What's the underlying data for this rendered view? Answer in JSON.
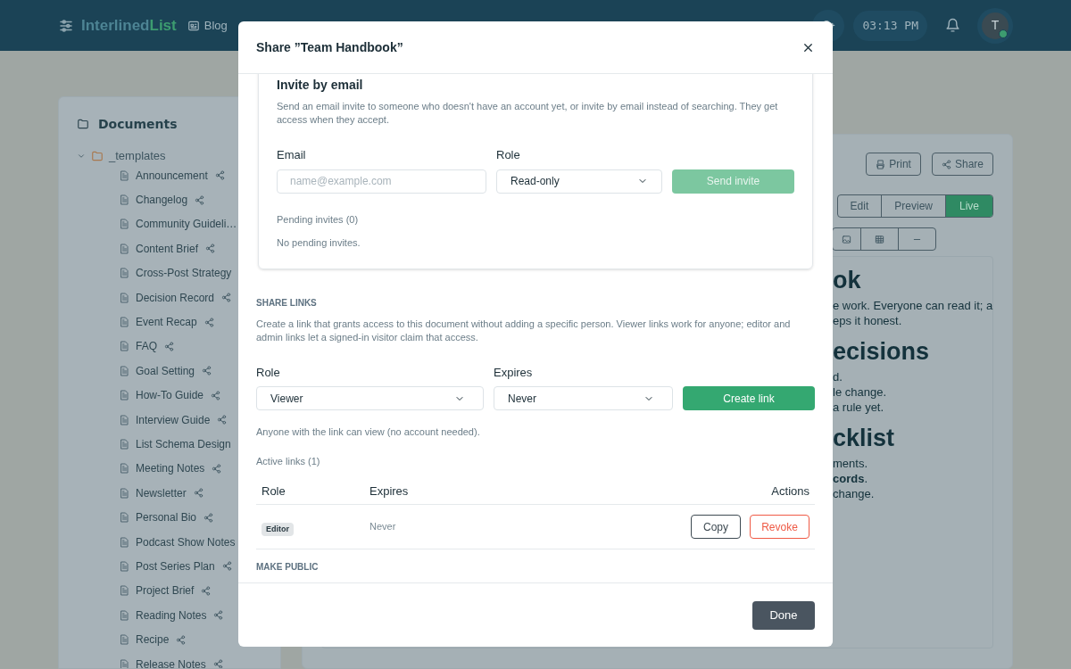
{
  "header": {
    "logo_parts": [
      "Interlined",
      "List"
    ],
    "nav": [
      {
        "label": "Blog"
      }
    ],
    "time": "03:13 PM",
    "avatar": "T"
  },
  "sidebar": {
    "title": "Documents",
    "tree": [
      {
        "label": "_templates",
        "expanded": true,
        "children": [
          {
            "label": "Announcement",
            "shared": true
          },
          {
            "label": "Changelog",
            "shared": true
          },
          {
            "label": "Community Guideli…",
            "shared": false
          },
          {
            "label": "Content Brief",
            "shared": true
          },
          {
            "label": "Cross-Post Strategy",
            "shared": false
          },
          {
            "label": "Decision Record",
            "shared": true
          },
          {
            "label": "Event Recap",
            "shared": true
          },
          {
            "label": "FAQ",
            "shared": true
          },
          {
            "label": "Goal Setting",
            "shared": true
          },
          {
            "label": "How-To Guide",
            "shared": true
          },
          {
            "label": "Interview Guide",
            "shared": true
          },
          {
            "label": "List Schema Design",
            "shared": false
          },
          {
            "label": "Meeting Notes",
            "shared": true
          },
          {
            "label": "Newsletter",
            "shared": true
          },
          {
            "label": "Personal Bio",
            "shared": true
          },
          {
            "label": "Podcast Show Notes",
            "shared": false
          },
          {
            "label": "Post Series Plan",
            "shared": true
          },
          {
            "label": "Project Brief",
            "shared": true
          },
          {
            "label": "Reading Notes",
            "shared": true
          },
          {
            "label": "Recipe",
            "shared": true
          },
          {
            "label": "Release Notes",
            "shared": true
          }
        ]
      }
    ]
  },
  "document": {
    "actions": [
      {
        "kind": "print",
        "label": "Print"
      },
      {
        "kind": "share",
        "label": "Share"
      }
    ],
    "modes": [
      {
        "label": "Edit",
        "selected": false
      },
      {
        "label": "Preview",
        "selected": false
      },
      {
        "label": "Live",
        "selected": true
      }
    ],
    "content": [
      {
        "kind": "heading",
        "text": "ok"
      },
      {
        "kind": "line",
        "text": "e work. Everyone can read it; a"
      },
      {
        "kind": "line",
        "text": "eps it honest."
      },
      {
        "kind": "heading",
        "text": "ecisions"
      },
      {
        "kind": "line",
        "text": "d."
      },
      {
        "kind": "line",
        "text": "le change."
      },
      {
        "kind": "line",
        "text": "a rule yet."
      },
      {
        "kind": "heading",
        "text": "cklist"
      },
      {
        "kind": "line",
        "text": "ments."
      },
      {
        "kind": "line",
        "text": "**cords**."
      },
      {
        "kind": "line",
        "text": "change."
      }
    ]
  },
  "modal": {
    "title": "Share ”Team Handbook”",
    "invite": {
      "title": "Invite by email",
      "description": "Send an email invite to someone who doesn't have an account yet, or invite by email instead of searching. They get access when they accept.",
      "email_label": "Email",
      "email_placeholder": "name@example.com",
      "role_label": "Role",
      "role_value": "Read-only",
      "button": {
        "label": "Send invite",
        "disabled": true
      },
      "pending_title": "Pending invites (0)",
      "pending_empty": "No pending invites."
    },
    "share_links": {
      "title": "SHARE LINKS",
      "description": "Create a link that grants access to this document without adding a specific person. Viewer links work for anyone; editor and admin links let a signed-in visitor claim that access.",
      "role_label": "Role",
      "role_value": "Viewer",
      "expires_label": "Expires",
      "expires_value": "Never",
      "button": {
        "label": "Create link",
        "disabled": false
      },
      "note": "Anyone with the link can view (no account needed).",
      "active_title": "Active links (1)",
      "table": {
        "columns": [
          "Role",
          "Expires",
          "Actions"
        ],
        "rows": [
          {
            "role": "Editor",
            "expires": "Never",
            "actions": [
              {
                "kind": "neutral",
                "label": "Copy"
              },
              {
                "kind": "danger",
                "label": "Revoke"
              }
            ]
          }
        ]
      }
    },
    "make_public": {
      "title": "MAKE PUBLIC"
    },
    "done": "Done"
  }
}
